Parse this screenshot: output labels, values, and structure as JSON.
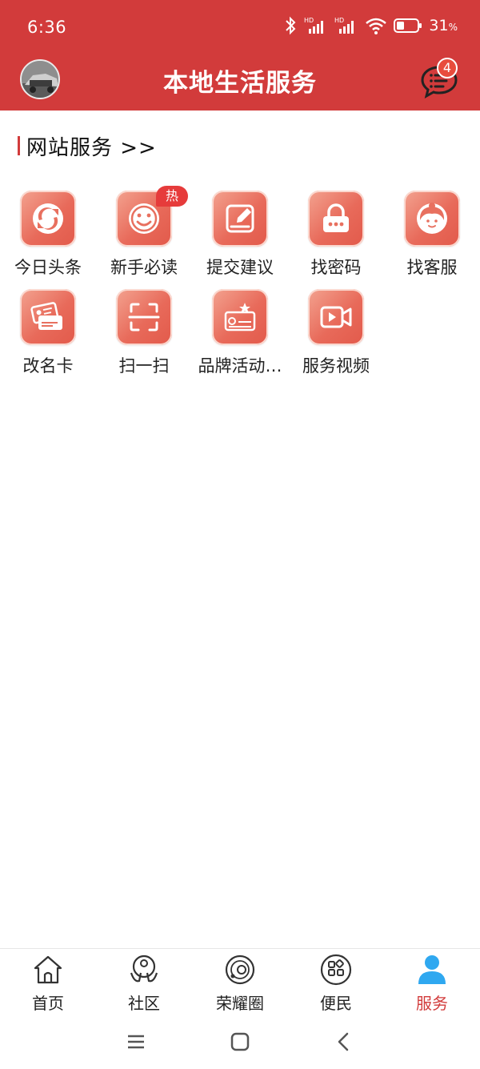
{
  "status": {
    "time": "6:36",
    "battery": "31",
    "battery_unit": "%"
  },
  "header": {
    "title": "本地生活服务",
    "message_count": "4"
  },
  "section": {
    "title": "网站服务 >>"
  },
  "services": [
    {
      "label": "今日头条",
      "icon": "refresh-icon"
    },
    {
      "label": "新手必读",
      "icon": "smile-icon",
      "badge": "热"
    },
    {
      "label": "提交建议",
      "icon": "edit-icon"
    },
    {
      "label": "找密码",
      "icon": "lock-icon"
    },
    {
      "label": "找客服",
      "icon": "customer-service-icon"
    },
    {
      "label": "改名卡",
      "icon": "id-card-icon"
    },
    {
      "label": "扫一扫",
      "icon": "scan-icon"
    },
    {
      "label": "品牌活动…",
      "icon": "brand-activity-icon"
    },
    {
      "label": "服务视频",
      "icon": "video-icon"
    }
  ],
  "tabs": [
    {
      "label": "首页",
      "icon": "home-icon"
    },
    {
      "label": "社区",
      "icon": "community-icon"
    },
    {
      "label": "荣耀圈",
      "icon": "planet-icon"
    },
    {
      "label": "便民",
      "icon": "apps-icon"
    },
    {
      "label": "服务",
      "icon": "user-icon",
      "active": true
    }
  ],
  "colors": {
    "primary": "#d23b3b",
    "icon_gradient_start": "#f3a390",
    "icon_gradient_end": "#e25a4b",
    "active_tab_icon": "#2fa8f0"
  }
}
